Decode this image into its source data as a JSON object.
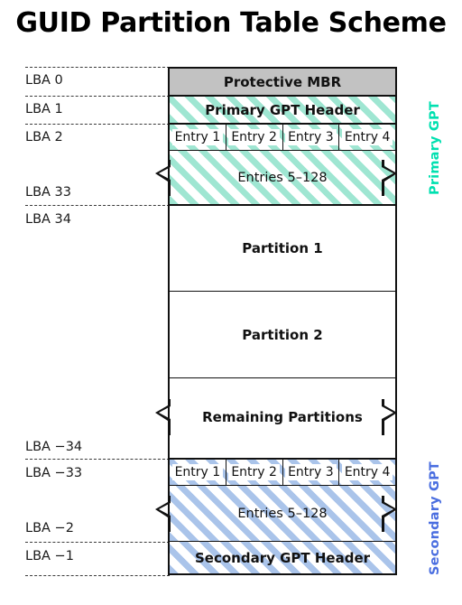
{
  "title": "GUID Partition Table Scheme",
  "side_labels": {
    "primary": {
      "text": "Primary GPT",
      "color": "#00e0b0"
    },
    "secondary": {
      "text": "Secondary GPT",
      "color": "#4a6ee0"
    }
  },
  "lba_labels": [
    {
      "key": "lba0",
      "text": "LBA 0"
    },
    {
      "key": "lba1",
      "text": "LBA 1"
    },
    {
      "key": "lba2",
      "text": "LBA 2"
    },
    {
      "key": "lba33",
      "text": "LBA 33"
    },
    {
      "key": "lba34",
      "text": "LBA 34"
    },
    {
      "key": "lba_m34",
      "text": "LBA −34"
    },
    {
      "key": "lba_m33",
      "text": "LBA −33"
    },
    {
      "key": "lba_m2",
      "text": "LBA −2"
    },
    {
      "key": "lba_m1",
      "text": "LBA −1"
    }
  ],
  "blocks": {
    "protective_mbr": {
      "label": "Protective MBR",
      "fill": "#c2c2c2"
    },
    "primary_gpt_header": {
      "label": "Primary GPT Header",
      "fill": "hatch-teal"
    },
    "primary_entries_1_4": {
      "cells": [
        "Entry 1",
        "Entry 2",
        "Entry 3",
        "Entry 4"
      ],
      "fill": "hatch-teal"
    },
    "primary_entries_5_128": {
      "label": "Entries 5–128",
      "fill": "hatch-teal"
    },
    "partition_1": {
      "label": "Partition 1",
      "fill": "#ffffff"
    },
    "partition_2": {
      "label": "Partition 2",
      "fill": "#ffffff"
    },
    "remaining_partitions": {
      "label": "Remaining Partitions",
      "fill": "#ffffff"
    },
    "secondary_entries_1_4": {
      "cells": [
        "Entry 1",
        "Entry 2",
        "Entry 3",
        "Entry 4"
      ],
      "fill": "hatch-blue"
    },
    "secondary_entries_5_128": {
      "label": "Entries 5–128",
      "fill": "hatch-blue"
    },
    "secondary_gpt_header": {
      "label": "Secondary GPT Header",
      "fill": "hatch-blue"
    }
  },
  "colors": {
    "outline": "#111111",
    "mbr_gray": "#c2c2c2",
    "hatch_teal": "#9fe6d2",
    "hatch_blue": "#aac4ea",
    "leader_dash": "#3a3a3a"
  }
}
